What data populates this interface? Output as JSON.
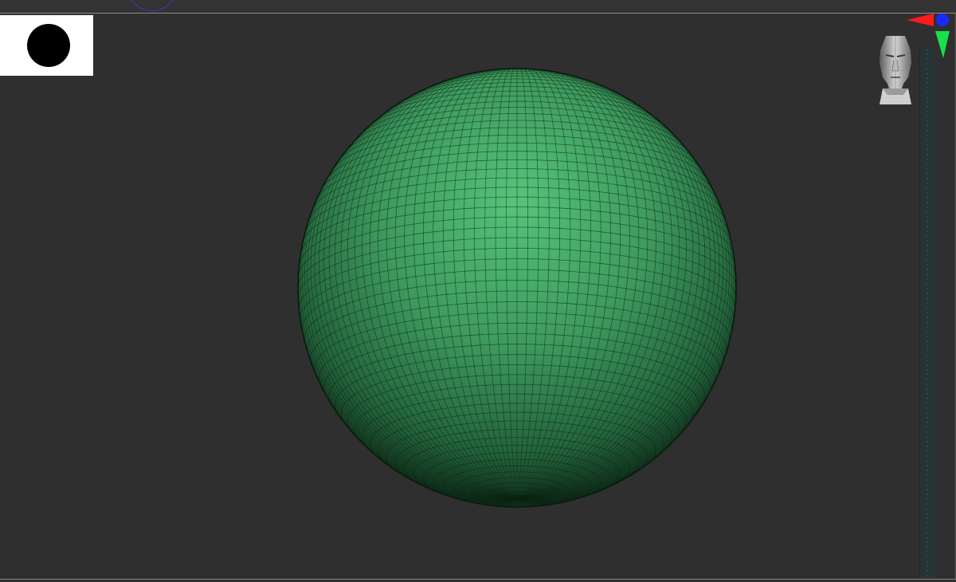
{
  "app": {
    "name": ""
  },
  "viewport": {
    "alpha_preview": {
      "shape": "round",
      "fill": "#000000",
      "background": "#ffffff"
    },
    "model": {
      "type": "sphere",
      "material_color": "#3d9c5d",
      "wireframe": true
    },
    "orientation_widget": {
      "head_icon": "head-bust-icon",
      "axis_colors": {
        "x": "#ff1a1a",
        "y": "#18e04a",
        "z": "#1a2aff"
      }
    },
    "brush_cursor_color": "#3a3ab4"
  }
}
